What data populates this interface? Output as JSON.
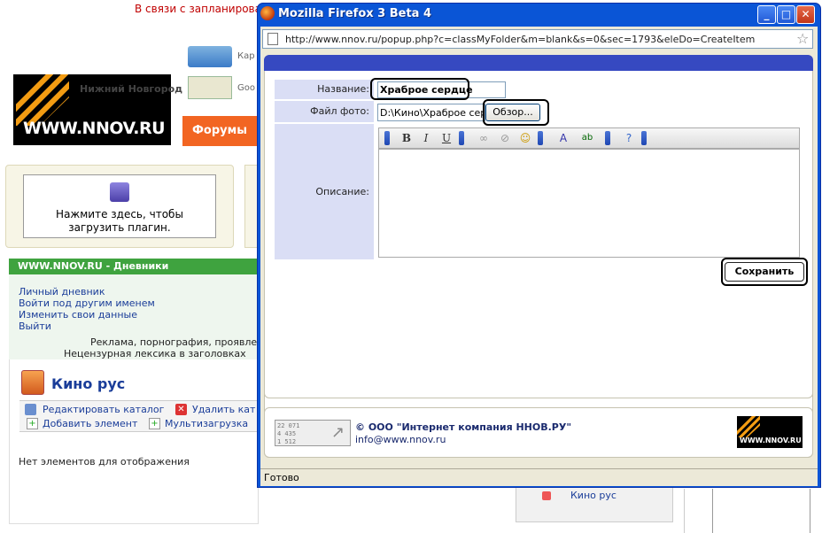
{
  "background": {
    "warning": "В связи с запланирова",
    "logo_text": "WWW.NNOV.RU",
    "city": "Нижний Новгород",
    "card_label": "Кар",
    "google_label": "Goo",
    "forums": "Форумы",
    "plugin_text": "Нажмите здесь, чтобы загрузить плагин.",
    "diary_header": "WWW.NNOV.RU - Дневники",
    "diary_links": [
      "Личный дневник",
      "Войти под другим именем",
      "Изменить свои данные",
      "Выйти"
    ],
    "disclaimer_1": "Реклама, порнография, проявле",
    "disclaimer_2": "Нецензурная лексика в заголовках",
    "folder_title": "Кино рус",
    "actions": {
      "edit_catalog": "Редактировать каталог",
      "delete_catalog": "Удалить кат",
      "add_element": "Добавить элемент",
      "multi_upload": "Мультизагрузка"
    },
    "no_items": "Нет элементов для отображения",
    "right_link": "Кино рус"
  },
  "window": {
    "title": "Mozilla Firefox 3 Beta 4",
    "url": "http://www.nnov.ru/popup.php?c=classMyFolder&m=blank&s=0&sec=1793&eleDo=CreateItem",
    "status": "Готово"
  },
  "form": {
    "name_label": "Название:",
    "name_value": "Храброе сердце",
    "photo_label": "Файл фото:",
    "photo_value": "D:\\Кино\\Храброе серд",
    "browse_label": "Обзор...",
    "description_label": "Описание:",
    "save_label": "Сохранить"
  },
  "footer": {
    "counter_lines": [
      "22 071",
      "4 435",
      "1 512"
    ],
    "copyright": "© ООО \"Интернет компания ННОВ.РУ\"",
    "email": "info@www.nnov.ru",
    "mini_logo_text": "WWW.NNOV.RU"
  }
}
